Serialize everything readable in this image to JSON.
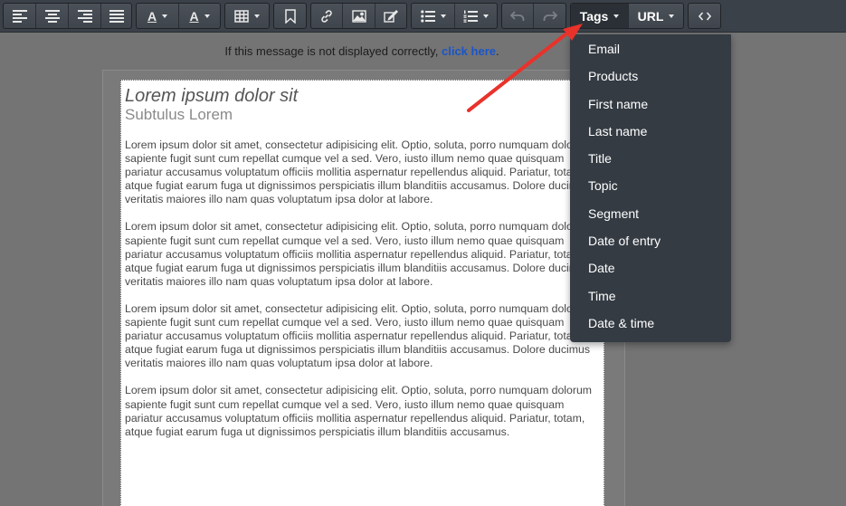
{
  "toolbar": {
    "icons": [
      "align-left-icon",
      "align-center-icon",
      "align-right-icon",
      "align-justify-icon",
      "text-color-icon",
      "highlight-color-icon",
      "table-icon",
      "bookmark-icon",
      "link-icon",
      "image-icon",
      "edit-icon",
      "bullet-list-icon",
      "numbered-list-icon",
      "undo-icon",
      "redo-icon",
      "code-icon"
    ],
    "text_color_letter": "A",
    "highlight_letter": "A",
    "tags_label": "Tags",
    "url_label": "URL",
    "accent_color": "#3b4148"
  },
  "notice": {
    "text": "If this message is not displayed correctly, ",
    "link": "click here",
    "suffix": "."
  },
  "email": {
    "title": "Lorem ipsum dolor sit",
    "subtitle": "Subtulus Lorem",
    "paragraphs": [
      "Lorem ipsum dolor sit amet, consectetur adipisicing elit. Optio, soluta, porro numquam dolorum sapiente fugit sunt cum repellat cumque vel a sed. Vero, iusto illum nemo quae quisquam pariatur accusamus voluptatum officiis mollitia aspernatur repellendus aliquid. Pariatur, totam, atque fugiat earum fuga ut dignissimos perspiciatis illum blanditiis accusamus. Dolore ducimus veritatis maiores illo nam quas voluptatum ipsa dolor at labore.",
      "Lorem ipsum dolor sit amet, consectetur adipisicing elit. Optio, soluta, porro numquam dolorum sapiente fugit sunt cum repellat cumque vel a sed. Vero, iusto illum nemo quae quisquam pariatur accusamus voluptatum officiis mollitia aspernatur repellendus aliquid. Pariatur, totam, atque fugiat earum fuga ut dignissimos perspiciatis illum blanditiis accusamus. Dolore ducimus veritatis maiores illo nam quas voluptatum ipsa dolor at labore.",
      "Lorem ipsum dolor sit amet, consectetur adipisicing elit. Optio, soluta, porro numquam dolorum sapiente fugit sunt cum repellat cumque vel a sed. Vero, iusto illum nemo quae quisquam pariatur accusamus voluptatum officiis mollitia aspernatur repellendus aliquid. Pariatur, totam, atque fugiat earum fuga ut dignissimos perspiciatis illum blanditiis accusamus. Dolore ducimus veritatis maiores illo nam quas voluptatum ipsa dolor at labore.",
      "Lorem ipsum dolor sit amet, consectetur adipisicing elit. Optio, soluta, porro numquam dolorum sapiente fugit sunt cum repellat cumque vel a sed. Vero, iusto illum nemo quae quisquam pariatur accusamus voluptatum officiis mollitia aspernatur repellendus aliquid. Pariatur, totam, atque fugiat earum fuga ut dignissimos perspiciatis illum blanditiis accusamus."
    ]
  },
  "tags_menu": {
    "items": [
      "Email",
      "Products",
      "First name",
      "Last name",
      "Title",
      "Topic",
      "Segment",
      "Date of entry",
      "Date",
      "Time",
      "Date & time"
    ]
  },
  "annotation": {
    "arrow_color": "#e8322a"
  }
}
